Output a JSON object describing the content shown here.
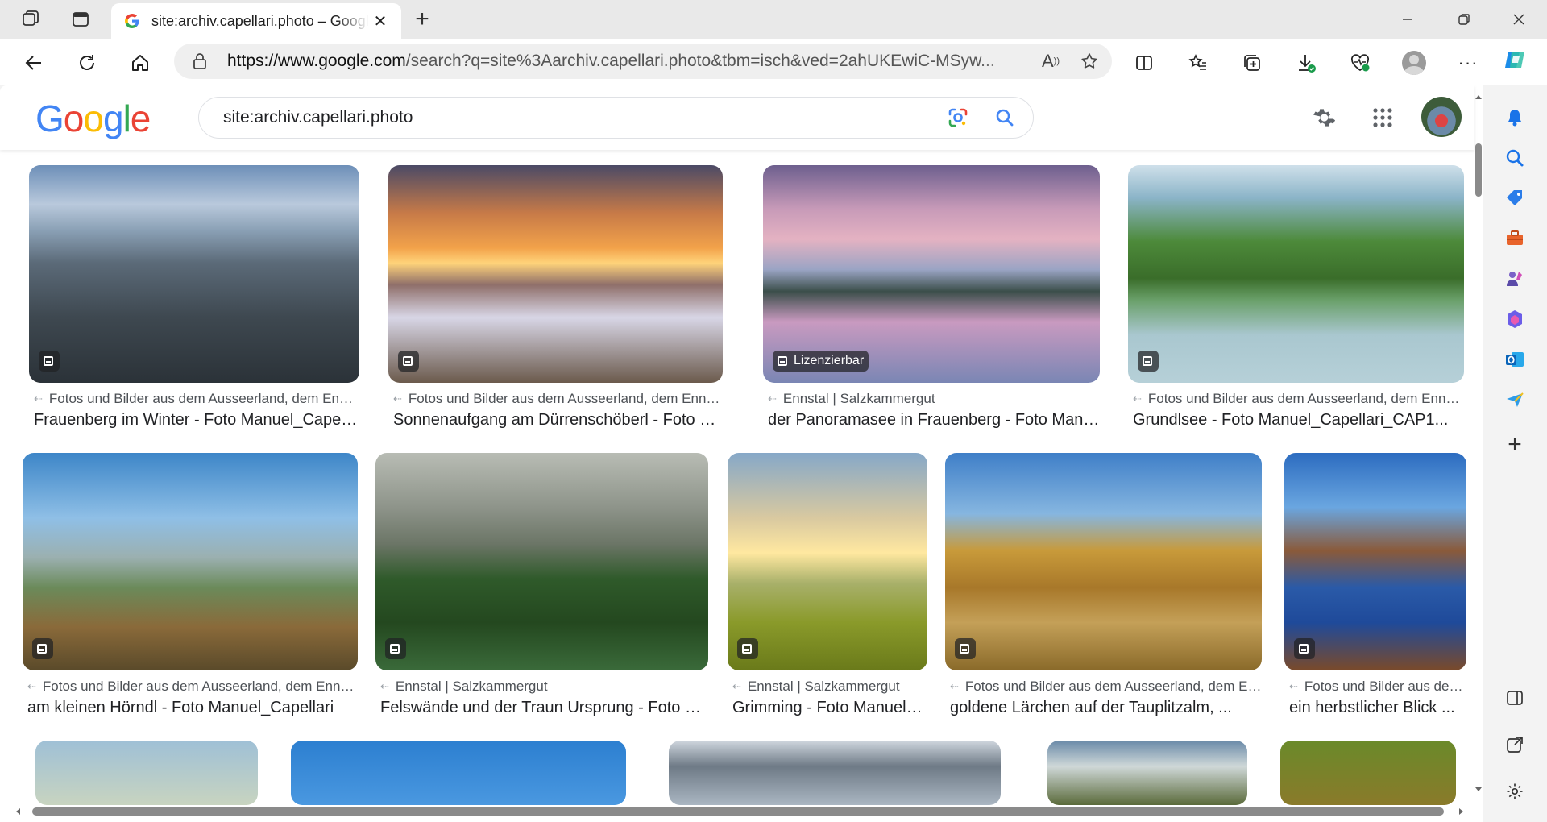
{
  "browser": {
    "tab_title": "site:archiv.capellari.photo – Google Suche",
    "url_host": "https://www.google.com",
    "url_path": "/search?q=site%3Aarchiv.capellari.photo&tbm=isch&ved=2ahUKEwiC-MSyw..."
  },
  "google": {
    "logo_letters": [
      "G",
      "o",
      "o",
      "g",
      "l",
      "e"
    ],
    "logo_colors": [
      "#4285f4",
      "#ea4335",
      "#fbbc05",
      "#4285f4",
      "#34a853",
      "#ea4335"
    ],
    "query": "site:archiv.capellari.photo"
  },
  "results": [
    {
      "source": "Fotos und Bilder aus dem Ausseerland, dem Ennstal...",
      "caption": "Frauenberg im Winter - Foto Manuel_Capellari",
      "badge": "",
      "bg": "linear-gradient(180deg,#6d8fb8 0%,#b9c9dc 18%,#8aa0b5 30%,#5b6a78 45%,#3e4850 70%,#2b3238 100%)"
    },
    {
      "source": "Fotos und Bilder aus dem Ausseerland, dem Ennstal...",
      "caption": "Sonnenaufgang am Dürrenschöberl - Foto Manuel_Capellari",
      "badge": "",
      "bg": "linear-gradient(180deg,#4b4a66 0%,#c77a48 22%,#f2a24a 38%,#ffd37a 45%,#8f6f6a 55%,#d8d6e6 70%,#6b5a4c 100%)"
    },
    {
      "source": "Ennstal | Salzkammergut",
      "caption": "der Panoramasee in Frauenberg - Foto Manuel_Capellari",
      "badge": "Lizenzierbar",
      "bg": "linear-gradient(180deg,#6d5f8e 0%,#c79ab8 20%,#e4b2c2 34%,#9aa4c4 48%,#3b4e4a 58%,#c99ac0 72%,#7a86b4 100%)"
    },
    {
      "source": "Fotos und Bilder aus dem Ausseerland, dem Ennstal...",
      "caption": "Grundlsee - Foto Manuel_Capellari_CAP1...",
      "badge": "",
      "bg": "linear-gradient(180deg,#cfe0ea 0%,#8bb4c8 15%,#4d8a3a 35%,#3a6d2a 52%,#6aa06a 62%,#a9c7cf 78%,#b6d0d8 100%)"
    },
    {
      "source": "Fotos und Bilder aus dem Ausseerland, dem Ennstal...",
      "caption": "am kleinen Hörndl - Foto Manuel_Capellari",
      "badge": "",
      "bg": "linear-gradient(180deg,#3d86c8 0%,#8fbfe6 30%,#9bb0b0 48%,#6b8a5a 62%,#8a6a3a 80%,#5a4a2a 100%)"
    },
    {
      "source": "Ennstal | Salzkammergut",
      "caption": "Felswände und der Traun Ursprung - Foto Manuel_Capellari",
      "badge": "",
      "bg": "linear-gradient(180deg,#b8bcb4 0%,#8e948a 25%,#6b7566 42%,#2f5a2a 58%,#24481f 78%,#3a6a3a 100%)"
    },
    {
      "source": "Ennstal | Salzkammergut",
      "caption": "Grimming - Foto Manuel_Capellari",
      "badge": "",
      "bg": "linear-gradient(180deg,#86a8c8 0%,#d9c9a0 30%,#ffe8a0 46%,#a8b06a 60%,#8a9a2a 78%,#6a7a1a 100%)"
    },
    {
      "source": "Fotos und Bilder aus dem Ausseerland, dem Ennstal...",
      "caption": "goldene Lärchen auf der Tauplitzalm, ...",
      "badge": "",
      "bg": "linear-gradient(180deg,#3f7fc8 0%,#86b6e0 28%,#c89a3a 45%,#a8782a 62%,#c4a058 78%,#8a6a2a 100%)"
    },
    {
      "source": "Fotos und Bilder aus dem Ausseerland, dem Ennstal...",
      "caption": "ein herbstlicher Blick ...",
      "badge": "",
      "bg": "linear-gradient(180deg,#2c6cc0 0%,#6aa6e0 25%,#8a5a3a 45%,#2a5aa8 62%,#1f4a9a 78%,#7a4a2a 100%)"
    },
    {
      "source": "",
      "caption": "",
      "badge": "",
      "bg": "linear-gradient(180deg,#9fc0d6 0%,#c8d4c0 100%)"
    },
    {
      "source": "",
      "caption": "",
      "badge": "",
      "bg": "linear-gradient(180deg,#2c7fd0 0%,#4a98e0 100%)"
    },
    {
      "source": "",
      "caption": "",
      "badge": "",
      "bg": "linear-gradient(180deg,#cfd6de 0%,#6e7a86 40%,#aab6c2 100%)"
    },
    {
      "source": "",
      "caption": "",
      "badge": "",
      "bg": "linear-gradient(180deg,#6a8aa8 0%,#cfd8d8 40%,#5a6a3a 100%)"
    },
    {
      "source": "",
      "caption": "",
      "badge": "",
      "bg": "linear-gradient(180deg,#6a8a2a 0%,#8a7a2a 100%)"
    }
  ]
}
